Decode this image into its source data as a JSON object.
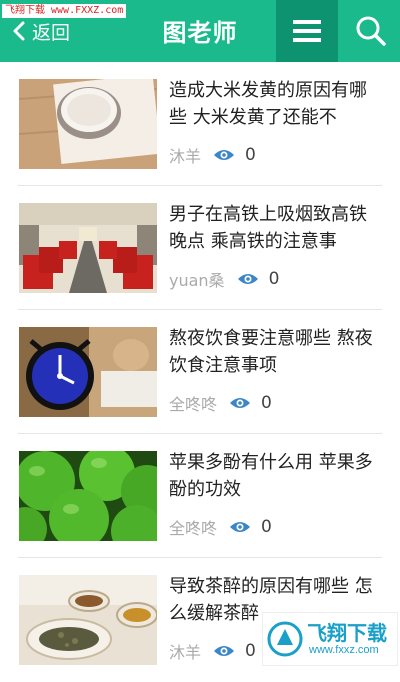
{
  "watermark": "飞翔下载 www.FXXZ.com",
  "header": {
    "back_label": "返回",
    "title": "图老师",
    "bg_color": "#1aba8c",
    "menu_bg_color": "#0e9370",
    "back_icon": "chevron-left-icon",
    "menu_icon": "hamburger-menu-icon",
    "search_icon": "search-icon"
  },
  "articles": [
    {
      "title": "造成大米发黄的原因有哪些 大米发黄了还能不",
      "author": "沐羊",
      "views": "0",
      "image": "rice-bowl-image"
    },
    {
      "title": "男子在高铁上吸烟致高铁晚点 乘高铁的注意事",
      "author": "yuan桑",
      "views": "0",
      "image": "train-interior-image"
    },
    {
      "title": "熬夜饮食要注意哪些 熬夜饮食注意事项",
      "author": "全咚咚",
      "views": "0",
      "image": "alarm-clock-image"
    },
    {
      "title": "苹果多酚有什么用 苹果多酚的功效",
      "author": "全咚咚",
      "views": "0",
      "image": "green-apples-image"
    },
    {
      "title": "导致茶醉的原因有哪些 怎么缓解茶醉",
      "author": "沐羊",
      "views": "0",
      "image": "tea-cups-image"
    }
  ],
  "badge": {
    "title": "飞翔下载",
    "url": "www.fxxz.com"
  },
  "colors": {
    "accent": "#1aba8c",
    "eye": "#3a86c6",
    "meta": "#aaaaaa"
  }
}
